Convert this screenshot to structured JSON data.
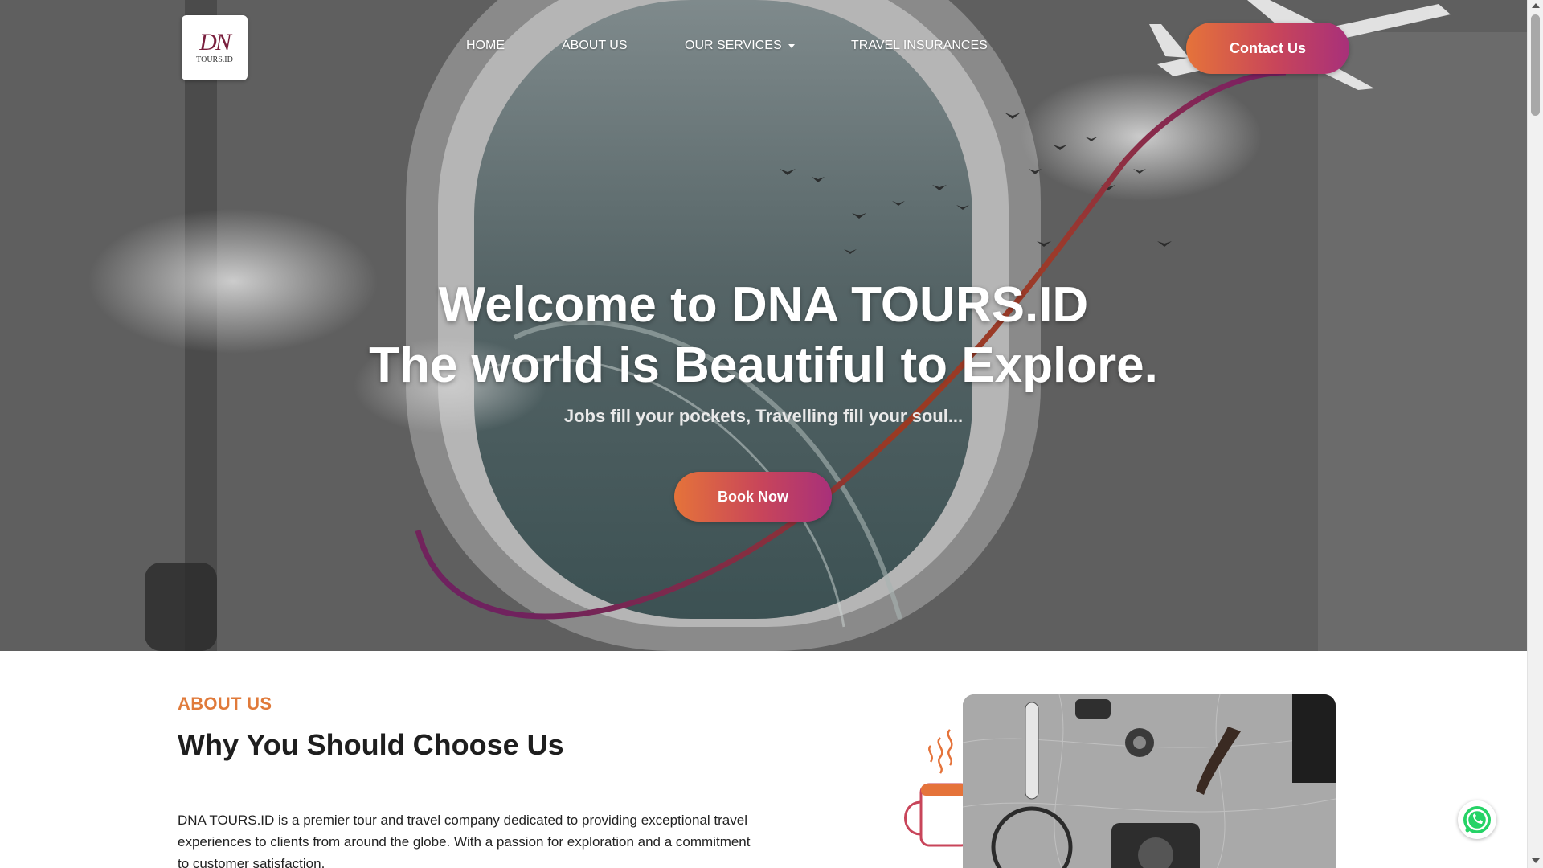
{
  "brand": {
    "logo_mark": "DN",
    "logo_text": "TOURS.ID"
  },
  "nav": {
    "items": [
      {
        "label": "HOME"
      },
      {
        "label": "ABOUT US"
      },
      {
        "label": "OUR SERVICES"
      },
      {
        "label": "TRAVEL INSURANCES"
      }
    ],
    "contact_label": "Contact Us"
  },
  "hero": {
    "title_line1": "Welcome to DNA TOURS.ID",
    "title_line2": "The world is Beautiful to Explore.",
    "subtitle": "Jobs fill your pockets, Travelling fill your soul...",
    "cta_label": "Book Now"
  },
  "about": {
    "label": "ABOUT US",
    "title": "Why You Should Choose Us",
    "body": "DNA TOURS.ID is a premier tour and travel company dedicated to providing exceptional travel experiences to clients from around the globe. With a passion for exploration and a commitment to customer satisfaction."
  },
  "colors": {
    "accent_orange": "#e5733a",
    "accent_magenta": "#a8307a",
    "label_orange": "#e07a3a",
    "whatsapp_green": "#25d366"
  },
  "icons": {
    "dropdown": "caret-down-icon",
    "chat": "whatsapp-icon"
  }
}
